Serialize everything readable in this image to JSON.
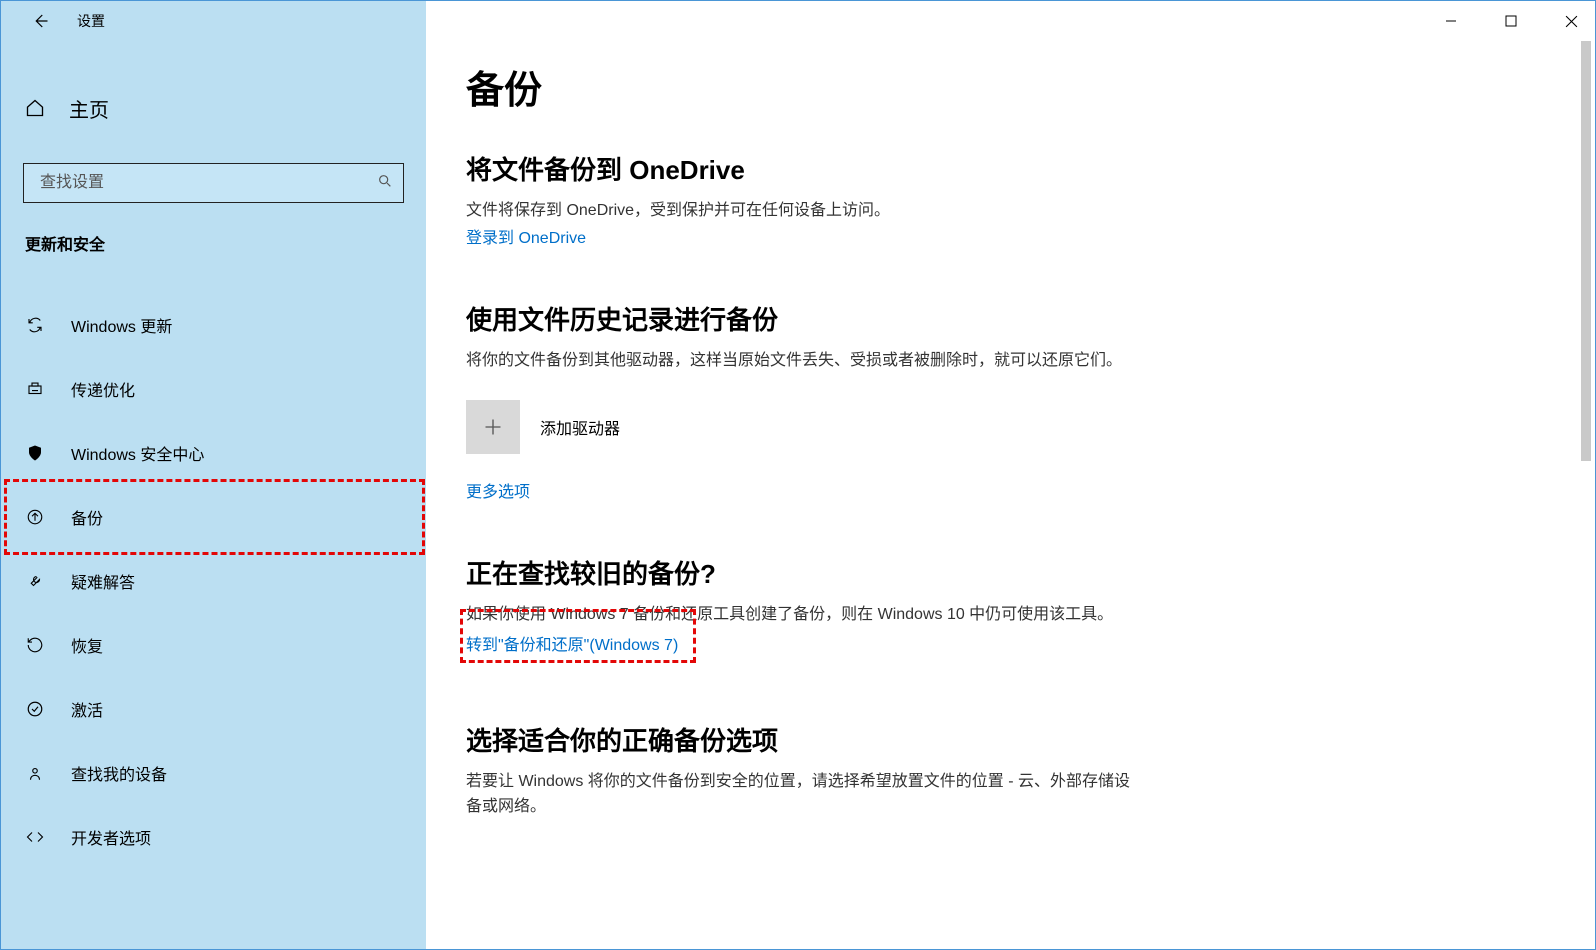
{
  "app": {
    "title": "设置"
  },
  "sidebar": {
    "home": "主页",
    "search_placeholder": "查找设置",
    "category": "更新和安全",
    "items": [
      {
        "icon": "refresh",
        "label": "Windows 更新"
      },
      {
        "icon": "delivery",
        "label": "传递优化"
      },
      {
        "icon": "shield",
        "label": "Windows 安全中心"
      },
      {
        "icon": "backup",
        "label": "备份"
      },
      {
        "icon": "wrench",
        "label": "疑难解答"
      },
      {
        "icon": "recovery",
        "label": "恢复"
      },
      {
        "icon": "check",
        "label": "激活"
      },
      {
        "icon": "find",
        "label": "查找我的设备"
      },
      {
        "icon": "dev",
        "label": "开发者选项"
      }
    ]
  },
  "main": {
    "title": "备份",
    "s1": {
      "heading": "将文件备份到 OneDrive",
      "text": "文件将保存到 OneDrive，受到保护并可在任何设备上访问。",
      "link": "登录到 OneDrive"
    },
    "s2": {
      "heading": "使用文件历史记录进行备份",
      "text": "将你的文件备份到其他驱动器，这样当原始文件丢失、受损或者被删除时，就可以还原它们。",
      "add_label": "添加驱动器",
      "more": "更多选项"
    },
    "s3": {
      "heading": "正在查找较旧的备份?",
      "text": "如果你使用 Windows 7 备份和还原工具创建了备份，则在 Windows 10 中仍可使用该工具。",
      "link": "转到\"备份和还原\"(Windows 7)"
    },
    "s4": {
      "heading": "选择适合你的正确备份选项",
      "text": "若要让 Windows 将你的文件备份到安全的位置，请选择希望放置文件的位置 - 云、外部存储设备或网络。"
    }
  }
}
